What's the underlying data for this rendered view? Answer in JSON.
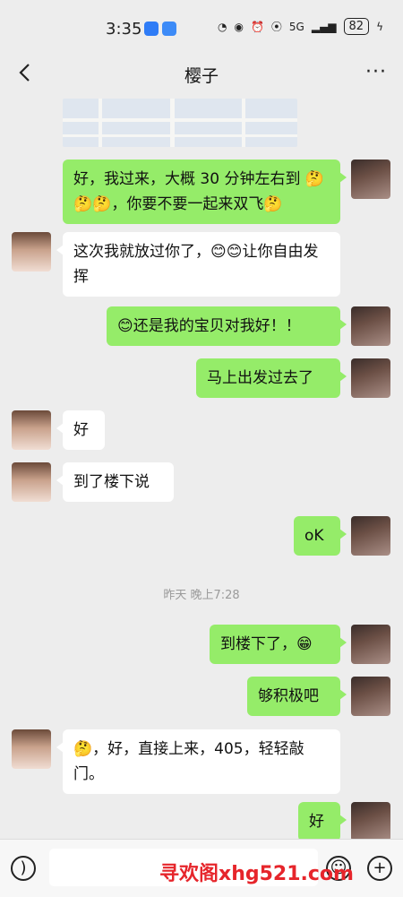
{
  "status_bar": {
    "time": "3:35",
    "battery": "82",
    "network": "5G"
  },
  "header": {
    "title": "樱子",
    "more": "···"
  },
  "messages": [
    {
      "from": "me",
      "text": "好，我过来，大概 30 分钟左右到 🤔🤔🤔，你要不要一起来双飞🤔"
    },
    {
      "from": "her",
      "text": "这次我就放过你了，😊😊让你自由发挥"
    },
    {
      "from": "me",
      "text": "😊还是我的宝贝对我好！！"
    },
    {
      "from": "me",
      "text": "马上出发过去了"
    },
    {
      "from": "her",
      "text": "好"
    },
    {
      "from": "her",
      "text": "到了楼下说"
    },
    {
      "from": "me",
      "text": "oK"
    },
    {
      "from": "me",
      "text": "到楼下了，😁"
    },
    {
      "from": "me",
      "text": "够积极吧"
    },
    {
      "from": "her",
      "text": "🤔，好，直接上来，405，轻轻敲门。"
    },
    {
      "from": "me",
      "text": "好"
    }
  ],
  "timestamp": "昨天 晚上7:28",
  "input_bar": {
    "watermark": "寻欢阁xhg521.com"
  },
  "colors": {
    "background": "#ededed",
    "my_bubble": "#95ec69",
    "her_bubble": "#ffffff",
    "watermark": "#e6252b"
  }
}
